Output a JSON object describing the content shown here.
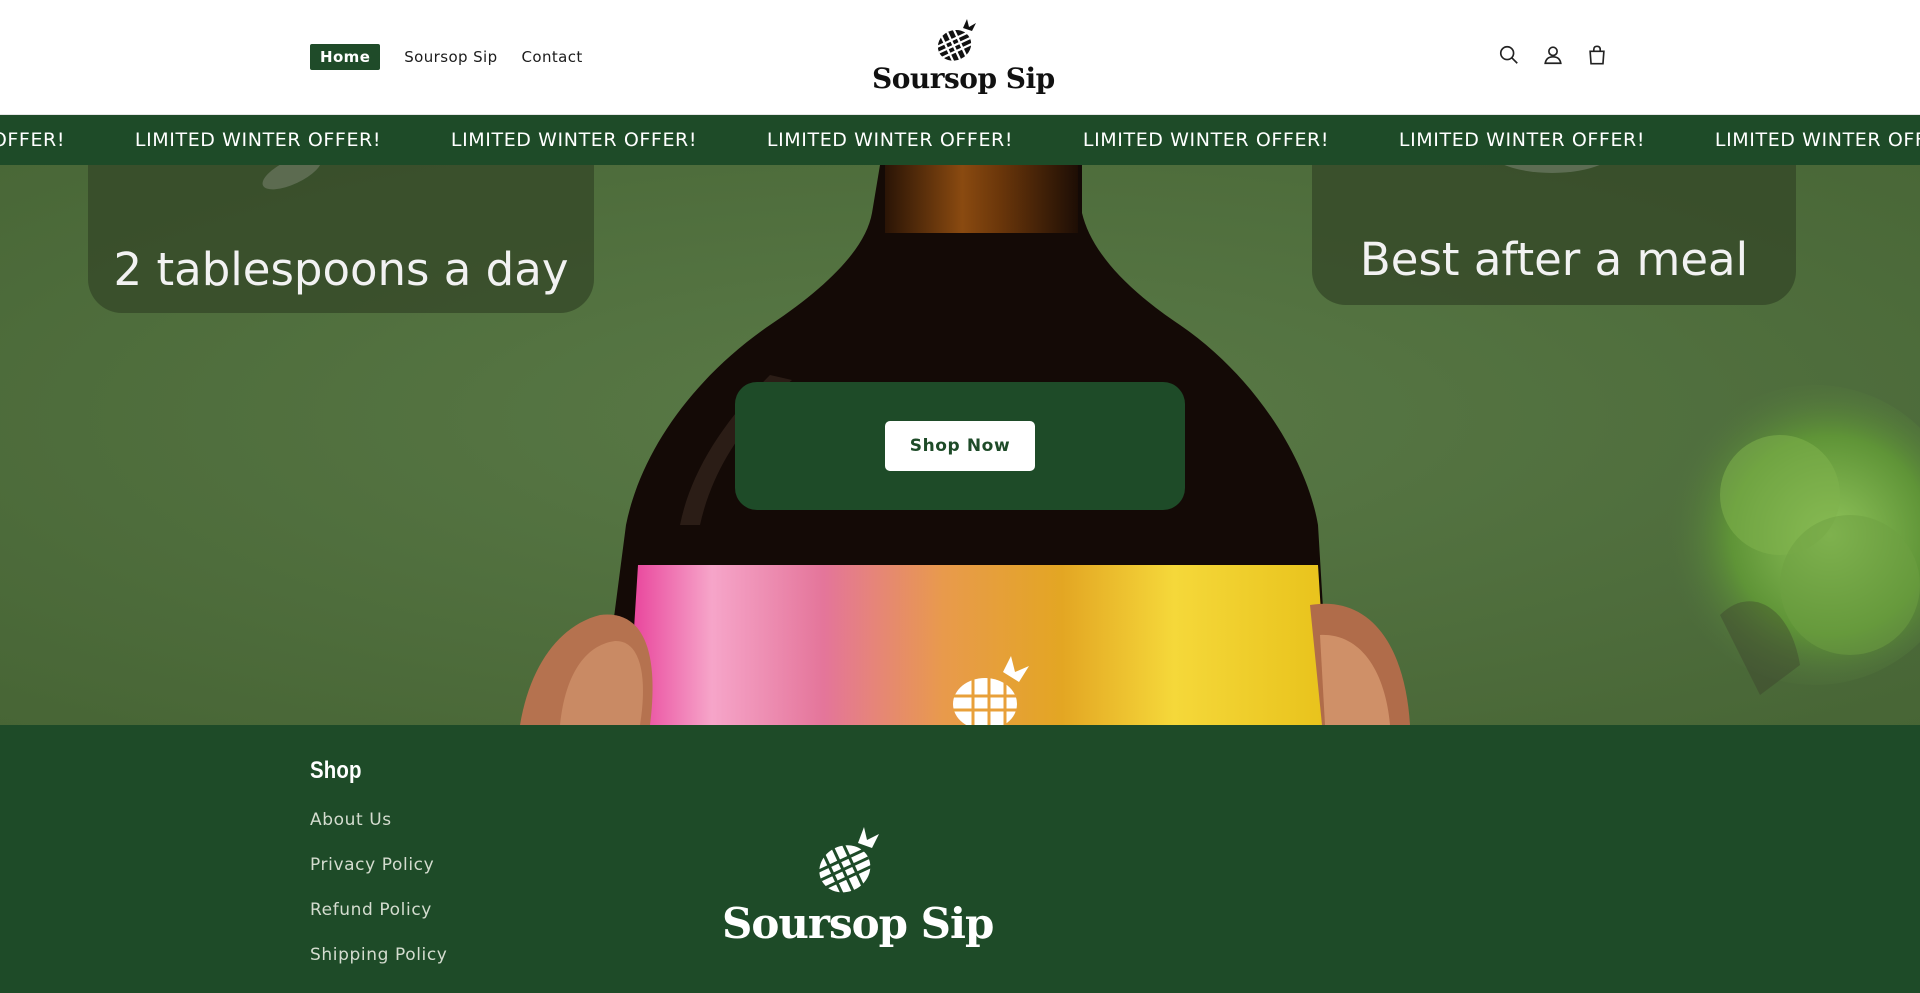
{
  "header": {
    "nav": [
      {
        "label": "Home",
        "active": true
      },
      {
        "label": "Soursop Sip",
        "active": false
      },
      {
        "label": "Contact",
        "active": false
      }
    ],
    "logo_text": "Soursop Sip",
    "icons": [
      "search-icon",
      "account-icon",
      "cart-icon"
    ]
  },
  "announcement": {
    "text": "LIMITED WINTER OFFER!",
    "repeat_count": 7
  },
  "hero": {
    "left_tip": "2 tablespoons a day",
    "right_tip": "Best after a meal",
    "cta_label": "Shop Now"
  },
  "footer": {
    "heading": "Shop",
    "links": [
      "About Us",
      "Privacy Policy",
      "Refund Policy",
      "Shipping Policy"
    ],
    "logo_text": "Soursop Sip"
  },
  "colors": {
    "brand_green": "#1e4b28",
    "hero_green": "#51703f",
    "white": "#ffffff"
  }
}
